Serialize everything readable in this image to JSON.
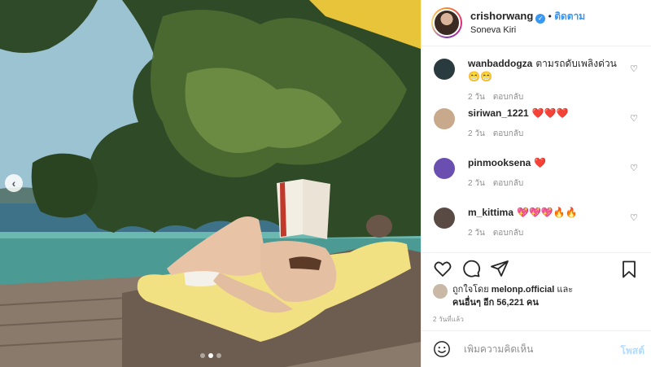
{
  "post": {
    "username": "crishorwang",
    "follow_label": "ติดตาม",
    "separator": "•",
    "location": "Soneva Kiri"
  },
  "comments": [
    {
      "user": "wanbaddogza",
      "text": "ตามรถดับเพลิงด่วน 😁😁",
      "age": "2 วัน",
      "reply": "ตอบกลับ",
      "avatar_color": "#2a3b3f"
    },
    {
      "user": "siriwan_1221",
      "text": "❤️❤️❤️",
      "age": "2 วัน",
      "reply": "ตอบกลับ",
      "avatar_color": "#c9a98c"
    },
    {
      "user": "pinmooksena",
      "text": "❤️",
      "age": "2 วัน",
      "reply": "ตอบกลับ",
      "avatar_color": "#6b4fb0"
    },
    {
      "user": "m_kittima",
      "text": "💖💖💖🔥🔥",
      "age": "2 วัน",
      "reply": "ตอบกลับ",
      "avatar_color": "#5a4a44"
    }
  ],
  "likes": {
    "prefix": "ถูกใจโดย",
    "liker": "melonp.official",
    "and": "และ",
    "others": "คนอื่นๆ อีก 56,221 คน"
  },
  "timestamp": "2 วันที่แล้ว",
  "composer": {
    "placeholder": "เพิ่มความคิดเห็น",
    "post_label": "โพสต์"
  },
  "carousel": {
    "prev_glyph": "‹",
    "current": 2,
    "total": 3
  },
  "colors": {
    "accent": "#3897f0",
    "text": "#262626",
    "muted": "#8e8e8e"
  },
  "icons": [
    "heart-icon",
    "comment-icon",
    "share-icon",
    "bookmark-icon",
    "emoji-icon",
    "verified-icon"
  ]
}
